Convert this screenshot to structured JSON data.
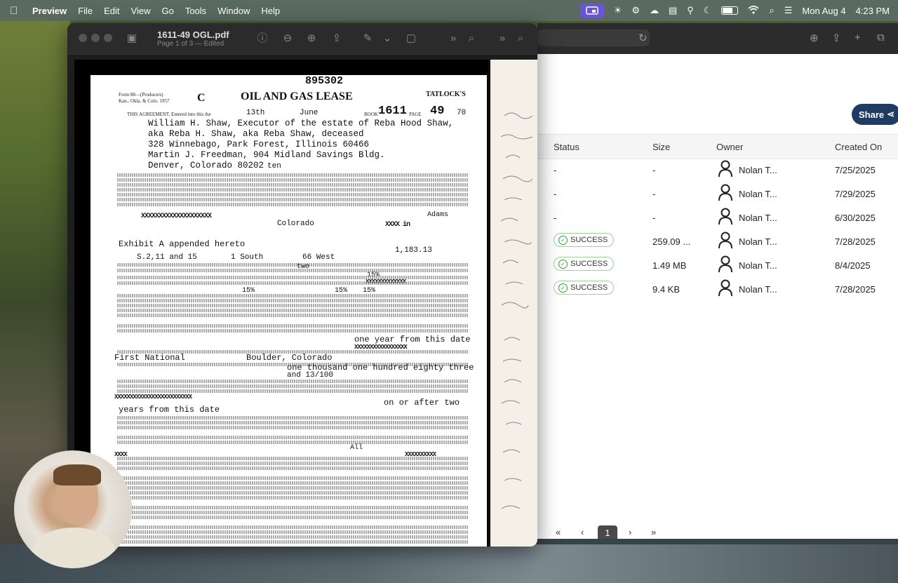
{
  "menubar": {
    "app_name": "Preview",
    "items": [
      "File",
      "Edit",
      "View",
      "Go",
      "Tools",
      "Window",
      "Help"
    ],
    "date": "Mon Aug 4",
    "time": "4:23 PM"
  },
  "preview": {
    "filename": "1611-49 OGL.pdf",
    "subtitle": "Page 1 of 3 — Edited"
  },
  "doc": {
    "top_number": "895302",
    "form_line1": "Form 88—(Producers)",
    "form_line2": "Kan., Okla. & Colo. 1957",
    "title": "OIL AND GAS LEASE",
    "brand": "TATLOCK'S",
    "agreement_label": "THIS AGREEMENT, Entered into this the",
    "day": "13th",
    "month": "June",
    "book_label": "BOOK",
    "book": "1611",
    "page_label": "PAGE",
    "page": "49",
    "year": "70",
    "lessor_lines": [
      "William H. Shaw, Executor of the estate of Reba Hood Shaw,",
      "aka Reba H. Shaw, aka Reba Shaw, deceased",
      "328 Winnebago, Park Forest, Illinois  60466"
    ],
    "lessee_line": "Martin J. Freedman, 904 Midland Savings Bldg.",
    "lessee_city": "Denver, Colorado  80202",
    "consideration": "ten",
    "county": "Adams",
    "state": "Colorado",
    "exhibit": "Exhibit A appended hereto",
    "sections": "S.2,11 and 15",
    "township": "1 South",
    "range": "66 West",
    "acres": "1,183.13",
    "term": "two",
    "royalty_a": "15%",
    "royalty_b": "15%",
    "royalty_c": "15%",
    "royalty_d": "15%",
    "one_year": "one year from this date",
    "bank": "First National",
    "bank_city": "Boulder, Colorado",
    "rental_words": "one thousand one hundred eighty three",
    "rental_words2": "and 13/100",
    "or_after": "on or after two",
    "years_date": "years from this date",
    "all_text": "All"
  },
  "browser": {
    "share_label": "Share",
    "headers": {
      "status": "Status",
      "size": "Size",
      "owner": "Owner",
      "created": "Created On"
    },
    "rows": [
      {
        "status": "-",
        "size": "-",
        "owner": "Nolan T...",
        "created": "7/25/2025"
      },
      {
        "status": "-",
        "size": "-",
        "owner": "Nolan T...",
        "created": "7/29/2025"
      },
      {
        "status": "-",
        "size": "-",
        "owner": "Nolan T...",
        "created": "6/30/2025"
      },
      {
        "status": "SUCCESS",
        "size": "259.09 ...",
        "owner": "Nolan T...",
        "created": "7/28/2025"
      },
      {
        "status": "SUCCESS",
        "size": "1.49 MB",
        "owner": "Nolan T...",
        "created": "8/4/2025"
      },
      {
        "status": "SUCCESS",
        "size": "9.4 KB",
        "owner": "Nolan T...",
        "created": "7/28/2025"
      }
    ],
    "pager": {
      "first": "«",
      "prev": "‹",
      "current": "1",
      "next": "›",
      "last": "»"
    }
  },
  "colors": {
    "share_bg": "#1f3b63",
    "success_border": "#9fd19a",
    "success_check": "#3a9a3a",
    "record_badge": "#6a55d9"
  }
}
